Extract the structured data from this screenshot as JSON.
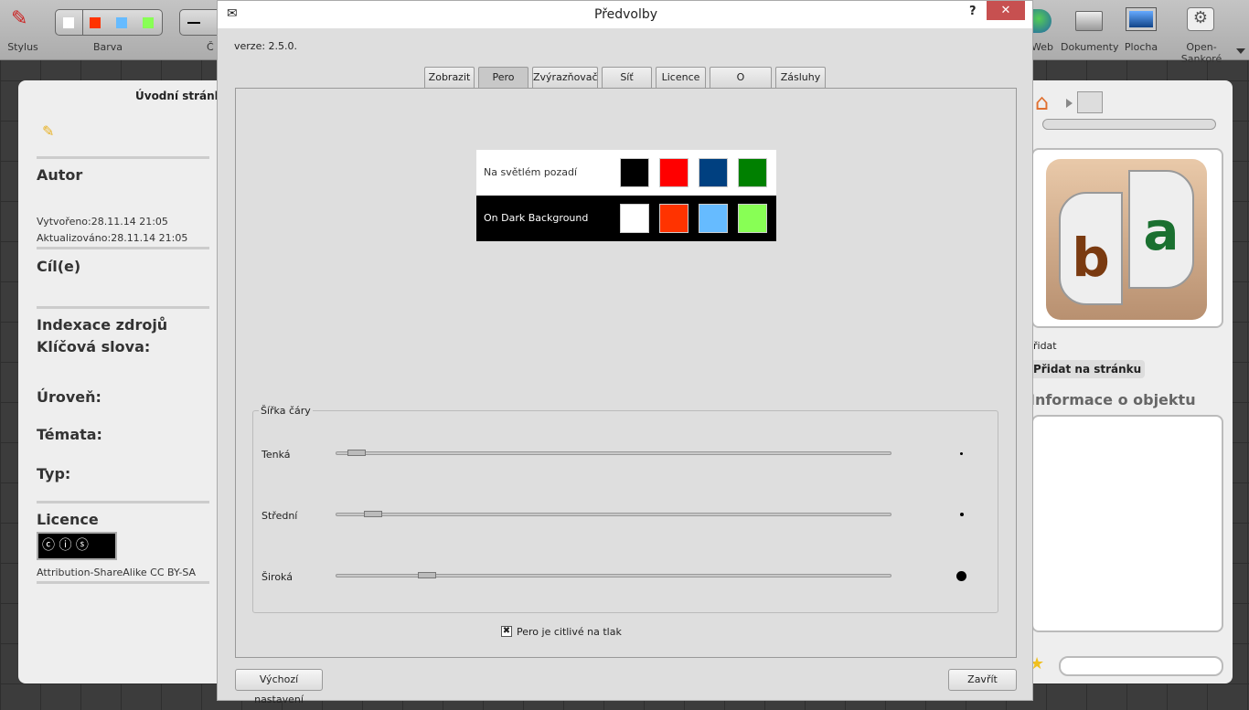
{
  "toolbar": {
    "stylus": "Stylus",
    "color": "Barva",
    "width_partial": "Č",
    "web": "Web",
    "documents": "Dokumenty",
    "desktop": "Plocha",
    "open_sankore": "Open-Sankoré",
    "colors": [
      "#ffffff",
      "#ff3300",
      "#66bbff",
      "#88ff55"
    ]
  },
  "left_panel": {
    "title": "Úvodní stránka",
    "author": "Autor",
    "created": "Vytvořeno:28.11.14 21:05",
    "updated": "Aktualizováno:28.11.14 21:05",
    "goals": "Cíl(e)",
    "indexing": "Indexace zdrojů",
    "keywords": "Klíčová slova:",
    "level": "Úroveň:",
    "topics": "Témata:",
    "type": "Typ:",
    "license": "Licence",
    "license_text": "Attribution-ShareAlike CC BY-SA"
  },
  "right_panel": {
    "add_partial": "řidat",
    "add_to_page": "Přidat na stránku",
    "object_info": "Informace o objektu",
    "letters": [
      "b",
      "a"
    ]
  },
  "dialog": {
    "title": "Předvolby",
    "help": "?",
    "close": "✕",
    "version": "verze: 2.5.0.",
    "tabs": [
      "Zobrazit",
      "Pero",
      "Zvýrazňovač",
      "Síť",
      "Licence",
      "O programu",
      "Zásluhy"
    ],
    "active_tab": "Pero",
    "light_bg": {
      "label": "Na světlém pozadí",
      "colors": [
        "#000000",
        "#ff0000",
        "#004080",
        "#008000"
      ]
    },
    "dark_bg": {
      "label": "On Dark Background",
      "colors": [
        "#ffffff",
        "#ff3300",
        "#66bbff",
        "#88ff55"
      ]
    },
    "line_width": {
      "title": "Šířka čáry",
      "thin": "Tenká",
      "medium": "Střední",
      "wide": "Široká"
    },
    "pressure": {
      "label": "Pero je citlivé na tlak",
      "checked": true
    },
    "defaults": "Výchozí nastavení",
    "close_button": "Zavřít"
  }
}
